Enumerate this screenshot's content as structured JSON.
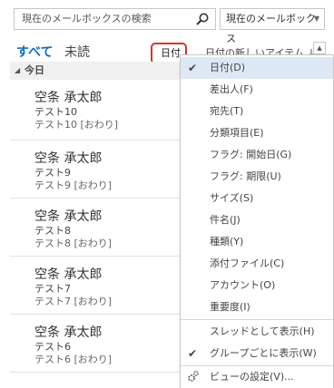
{
  "search": {
    "placeholder": "現在のメールボックスの検索",
    "icon": "search-icon",
    "scope_label": "現在のメールボックス"
  },
  "tabs": {
    "all": "すべて",
    "unread": "未読"
  },
  "sort": {
    "by_label": "日付",
    "order_label": "日付の新しいアイテム ↓"
  },
  "group": {
    "header": "今日"
  },
  "mail": [
    {
      "sender": "空条 承太郎",
      "subject": "テスト10",
      "preview": "テスト10 [おわり]"
    },
    {
      "sender": "空条 承太郎",
      "subject": "テスト9",
      "preview": "テスト9 [おわり]"
    },
    {
      "sender": "空条 承太郎",
      "subject": "テスト8",
      "preview": "テスト8 [おわり]"
    },
    {
      "sender": "空条 承太郎",
      "subject": "テスト7",
      "preview": "テスト7 [おわり]"
    },
    {
      "sender": "空条 承太郎",
      "subject": "テスト6",
      "preview": "テスト6 [おわり]"
    }
  ],
  "menu": {
    "arrange": [
      {
        "label": "日付(D)",
        "checked": true
      },
      {
        "label": "差出人(F)",
        "checked": false
      },
      {
        "label": "宛先(T)",
        "checked": false
      },
      {
        "label": "分類項目(E)",
        "checked": false
      },
      {
        "label": "フラグ: 開始日(G)",
        "checked": false
      },
      {
        "label": "フラグ: 期限(U)",
        "checked": false
      },
      {
        "label": "サイズ(S)",
        "checked": false
      },
      {
        "label": "件名(J)",
        "checked": false
      },
      {
        "label": "種類(Y)",
        "checked": false
      },
      {
        "label": "添付ファイル(C)",
        "checked": false
      },
      {
        "label": "アカウント(O)",
        "checked": false
      },
      {
        "label": "重要度(I)",
        "checked": false
      }
    ],
    "options": [
      {
        "label": "スレッドとして表示(H)",
        "checked": false
      },
      {
        "label": "グループごとに表示(W)",
        "checked": true
      }
    ],
    "view_settings": "ビューの設定(V)...",
    "view_settings_icon": "gear-icon"
  },
  "colors": {
    "accent": "#0f6fc6",
    "highlight_border": "#d9342b",
    "selected_bg": "#dde8f5"
  }
}
